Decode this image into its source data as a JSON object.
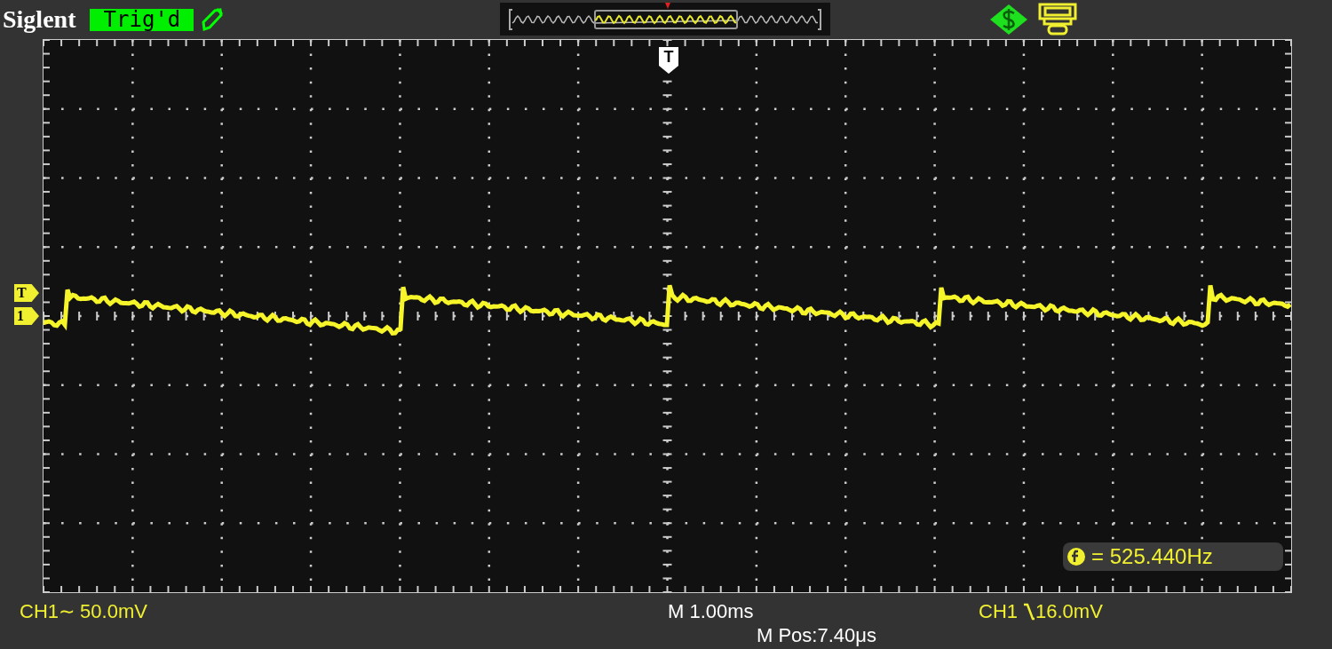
{
  "brand": "Siglent",
  "trigger_status": {
    "label": "Trig'd",
    "triggered": true
  },
  "top_marker": {
    "label": "T"
  },
  "left_markers": [
    {
      "label": "T",
      "kind": "trigger-level"
    },
    {
      "label": "1",
      "kind": "channel"
    }
  ],
  "measurement": {
    "value": "= 525.440Hz"
  },
  "bottom": {
    "channel_scale": "CH1∼ 50.0mV",
    "timebase": "M 1.00ms",
    "trigger_source": "CH1",
    "trigger_level": "16.0mV",
    "position": "M Pos:7.40μs"
  }
}
